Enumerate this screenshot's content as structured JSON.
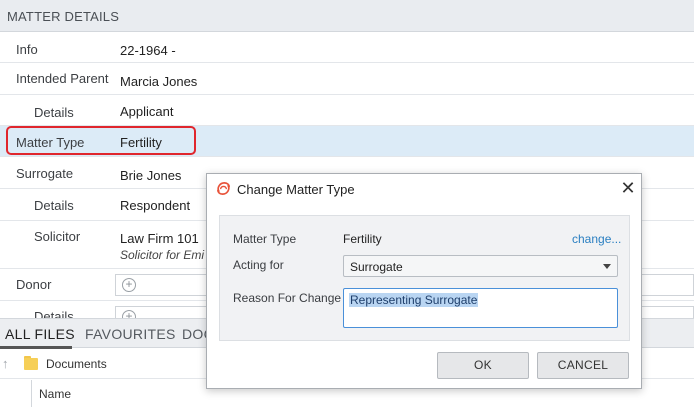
{
  "matter_details": {
    "header": "MATTER DETAILS",
    "rows": [
      {
        "label": "Info",
        "value": "22-1964 -"
      },
      {
        "label": "Intended Parent",
        "value": "Marcia Jones"
      },
      {
        "label": "Details",
        "value": "Applicant"
      },
      {
        "label": "Matter Type",
        "value": "Fertility"
      },
      {
        "label": "Surrogate",
        "value": "Brie Jones"
      },
      {
        "label": "Details",
        "value": "Respondent"
      },
      {
        "label": "Solicitor",
        "value": "Law Firm 101",
        "value2": "Solicitor for Emi"
      },
      {
        "label": "Donor",
        "value": ""
      },
      {
        "label": "Details",
        "value": ""
      }
    ]
  },
  "bottom_tabs": [
    "ALL FILES",
    "FAVOURITES",
    "DOC"
  ],
  "file_browser": {
    "path": "Documents",
    "column_header": "Name"
  },
  "dialog": {
    "title": "Change Matter Type",
    "matter_type_label": "Matter Type",
    "matter_type_value": "Fertility",
    "change_link": "change...",
    "acting_for_label": "Acting for",
    "acting_for_value": "Surrogate",
    "reason_label": "Reason For Change",
    "reason_value": "Representing Surrogate",
    "ok_label": "OK",
    "cancel_label": "CANCEL"
  },
  "colors": {
    "selected_row": "#dcebf7",
    "highlight_border": "#e0262d",
    "link": "#2a7fc1",
    "logo": "#e8533a"
  }
}
